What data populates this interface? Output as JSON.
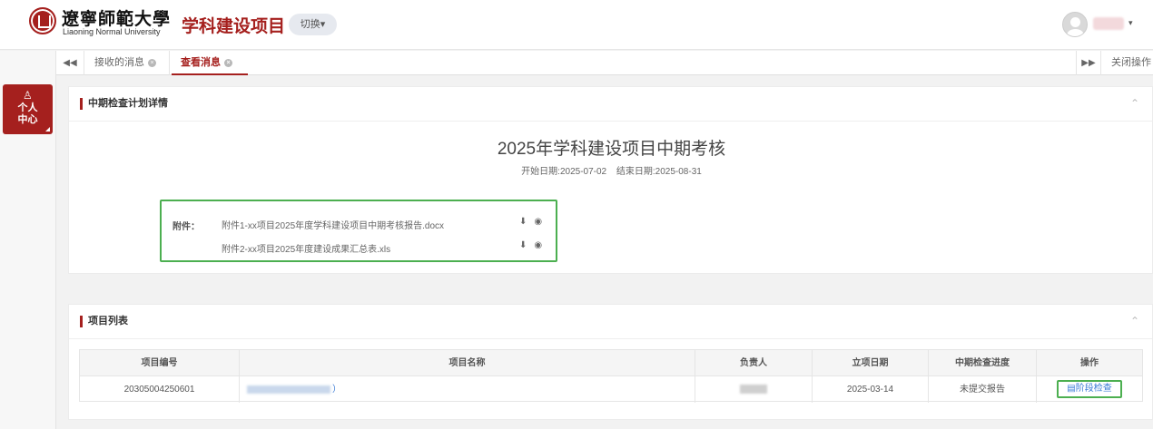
{
  "header": {
    "logo_cn": "遼寧師範大學",
    "logo_en": "Liaoning Normal University",
    "app_title": "学科建设项目",
    "switch_label": "切换",
    "switch_caret": "▾",
    "user_caret": "▾"
  },
  "sidebar": {
    "personal_center_icon": "♙",
    "personal_center_label": "个人中心"
  },
  "tabs": {
    "prev_label": "◀◀",
    "next_label": "▶▶",
    "close_label": "关闭操作",
    "close_glyph": "×",
    "items": [
      {
        "label": "接收的消息"
      },
      {
        "label": "查看消息"
      }
    ]
  },
  "detail_panel": {
    "title": "中期检查计划详情",
    "collapse_glyph": "⌃",
    "plan_title": "2025年学科建设项目中期考核",
    "start_label": "开始日期:2025-07-02",
    "end_label": "结束日期:2025-08-31",
    "attachments_label": "附件：",
    "attachments": [
      {
        "name": "附件1-xx项目2025年度学科建设项目中期考核报告.docx",
        "download_icon": "⬇",
        "view_icon": "◉"
      },
      {
        "name": "附件2-xx项目2025年度建设成果汇总表.xls",
        "download_icon": "⬇",
        "view_icon": "◉"
      }
    ]
  },
  "list_panel": {
    "title": "项目列表",
    "collapse_glyph": "⌃",
    "columns": [
      "项目编号",
      "项目名称",
      "负责人",
      "立项日期",
      "中期检查进度",
      "操作"
    ],
    "rows": [
      {
        "code": "20305004250601",
        "name_tail": "）",
        "date": "2025-03-14",
        "progress": "未提交报告",
        "action": "阶段检查",
        "action_icon": "▤"
      }
    ]
  },
  "colors": {
    "brand": "#a5201e",
    "highlight": "#4caf50",
    "link": "#3a7bd5"
  }
}
